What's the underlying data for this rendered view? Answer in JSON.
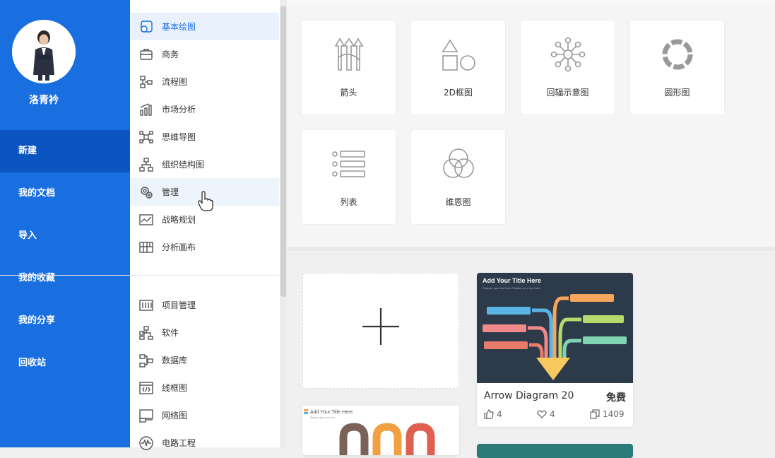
{
  "user": {
    "name": "洛青衿"
  },
  "nav": [
    "新建",
    "我的文档",
    "导入",
    "我的收藏",
    "我的分享",
    "回收站"
  ],
  "categories_top": [
    {
      "label": "基本绘图",
      "icon": "basic-drawing-icon"
    },
    {
      "label": "商务",
      "icon": "briefcase-icon"
    },
    {
      "label": "流程图",
      "icon": "flowchart-icon"
    },
    {
      "label": "市场分析",
      "icon": "bar-chart-icon"
    },
    {
      "label": "思维导图",
      "icon": "mind-map-icon"
    },
    {
      "label": "组织结构图",
      "icon": "org-chart-icon"
    },
    {
      "label": "管理",
      "icon": "gear-management-icon"
    },
    {
      "label": "战略规划",
      "icon": "strategy-chart-icon"
    },
    {
      "label": "分析画布",
      "icon": "canvas-grid-icon"
    }
  ],
  "categories_bottom": [
    {
      "label": "项目管理",
      "icon": "project-management-icon"
    },
    {
      "label": "软件",
      "icon": "software-icon"
    },
    {
      "label": "数据库",
      "icon": "database-icon"
    },
    {
      "label": "线框图",
      "icon": "wireframe-icon"
    },
    {
      "label": "网络图",
      "icon": "network-icon"
    },
    {
      "label": "电路工程",
      "icon": "circuit-icon"
    }
  ],
  "shapes": [
    {
      "label": "箭头",
      "icon": "arrows-shape-icon"
    },
    {
      "label": "2D框图",
      "icon": "2d-block-shape-icon"
    },
    {
      "label": "回辐示意图",
      "icon": "radial-shape-icon"
    },
    {
      "label": "圆形图",
      "icon": "circular-shape-icon"
    },
    {
      "label": "列表",
      "icon": "list-shape-icon"
    },
    {
      "label": "维恩图",
      "icon": "venn-shape-icon"
    }
  ],
  "templates": [
    {
      "title": "Arrow Diagram 20",
      "price": "免费",
      "likes": "4",
      "favorites": "4",
      "copies": "1409",
      "thumb": {
        "heading": "Add Your Title Here",
        "subheading": "Replace your text here   Replace your text here",
        "bg": "#2d3a4a",
        "colors": [
          "#5ab4e5",
          "#f08a8a",
          "#e97b6a",
          "#f5a55c",
          "#b7d86a",
          "#7fd4b4",
          "#f7c95c"
        ]
      }
    },
    {
      "thumb": {
        "heading": "Add Your Title Here",
        "subheading": "Replace your text here",
        "colors": [
          "#7a6258",
          "#f0a040",
          "#e06050"
        ]
      }
    }
  ],
  "colors": {
    "sidebar": "#1a6fe0",
    "sidebar_active": "#0a55c2",
    "selected_bg": "#e8f1fc",
    "accent": "#1a6fe0"
  }
}
